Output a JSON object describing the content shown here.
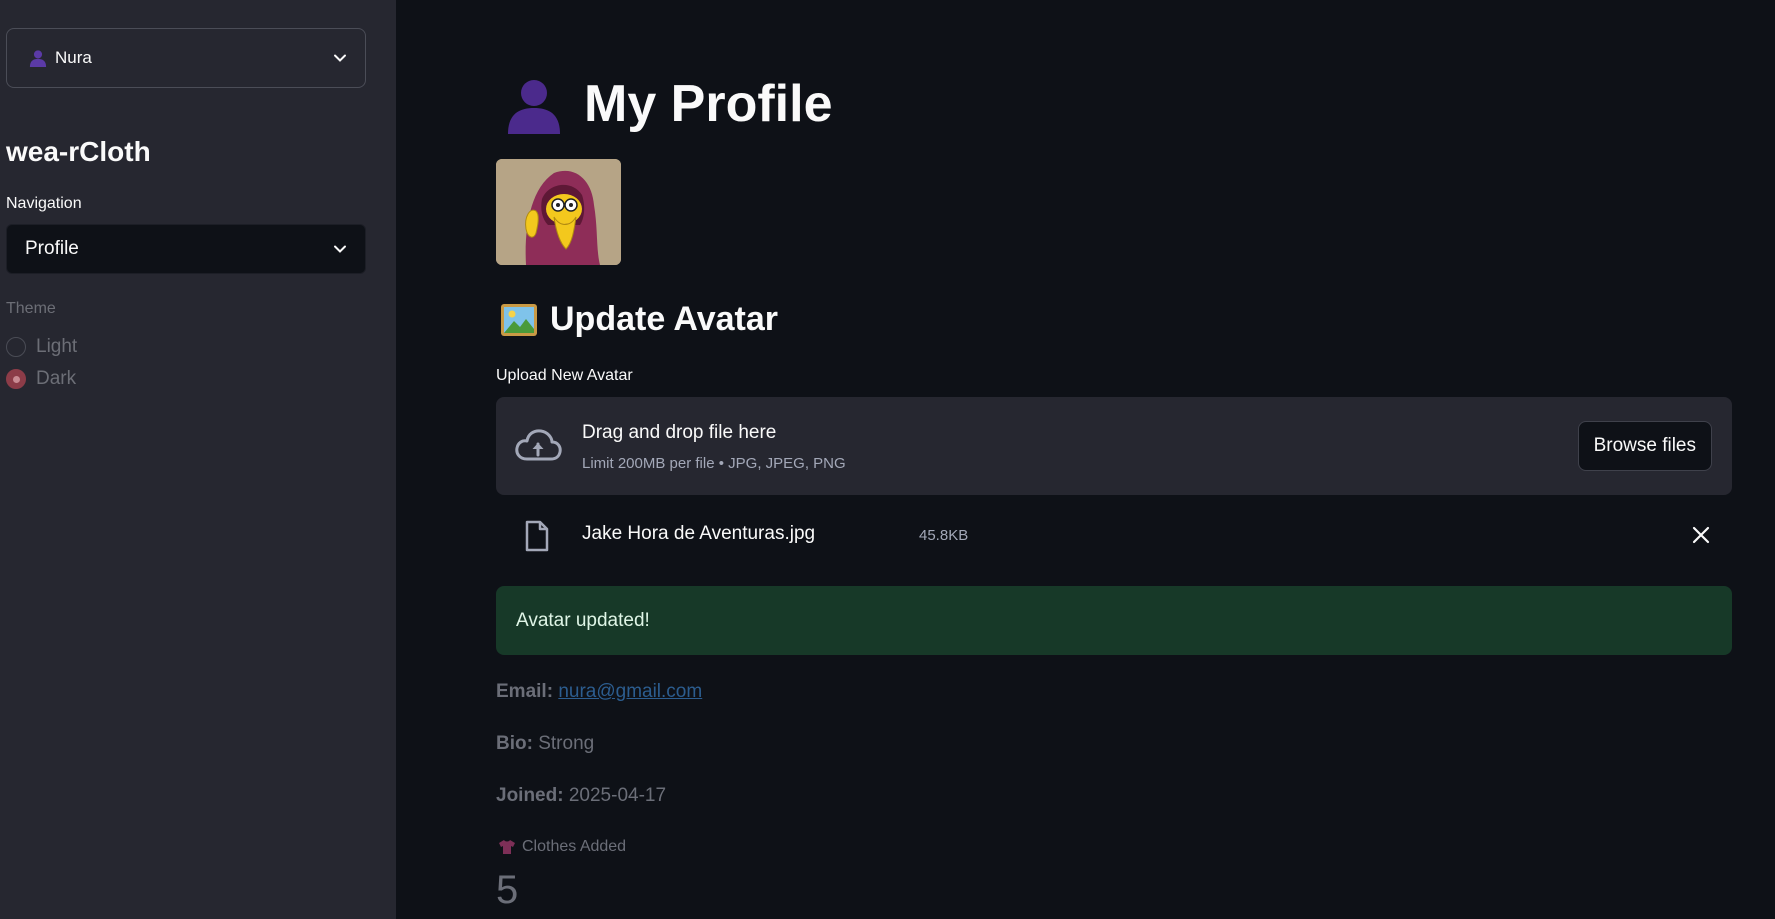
{
  "sidebar": {
    "user_select": {
      "value": "Nura",
      "icon": "user-silhouette-icon"
    },
    "app_title": "wea-rCloth",
    "navigation": {
      "label": "Navigation",
      "value": "Profile"
    },
    "theme": {
      "label": "Theme",
      "options": [
        {
          "label": "Light",
          "selected": false
        },
        {
          "label": "Dark",
          "selected": true
        }
      ]
    }
  },
  "main": {
    "title": "My Profile",
    "title_icon": "user-silhouette-icon",
    "update_avatar": {
      "title": "Update Avatar",
      "icon": "framed-picture-icon",
      "upload_label": "Upload New Avatar",
      "dropzone_title": "Drag and drop file here",
      "dropzone_sub": "Limit 200MB per file • JPG, JPEG, PNG",
      "browse_label": "Browse files",
      "file": {
        "name": "Jake Hora de Aventuras.jpg",
        "size": "45.8KB"
      }
    },
    "success_message": "Avatar updated!",
    "profile": {
      "email_label": "Email:",
      "email_value": "nura@gmail.com",
      "bio_label": "Bio:",
      "bio_value": "Strong",
      "joined_label": "Joined:",
      "joined_value": "2025-04-17"
    },
    "metric": {
      "label": "Clothes Added",
      "icon": "t-shirt-icon",
      "value": "5"
    }
  },
  "colors": {
    "background": "#0e1117",
    "sidebar": "#262730",
    "success_bg": "#173928",
    "accent_radio": "#8c3c48",
    "link": "#2c5d8f"
  }
}
